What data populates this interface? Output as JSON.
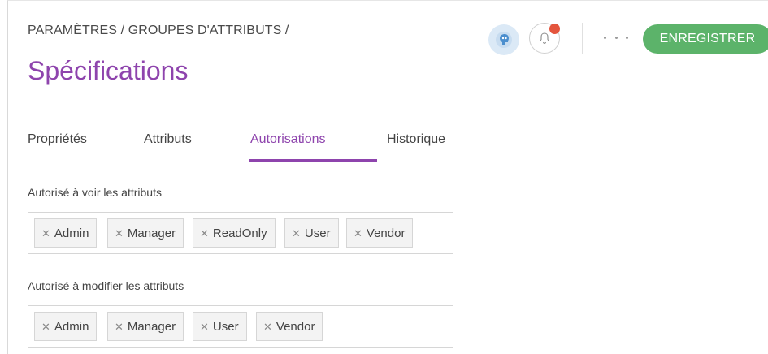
{
  "header": {
    "breadcrumb": "PARAMÈTRES / GROUPES D'ATTRIBUTS /",
    "title": "Spécifications",
    "save_label": "ENREGISTRER",
    "colors": {
      "accent": "#8e44ad",
      "save": "#5cb36a",
      "notification_dot": "#e4553d"
    }
  },
  "tabs": [
    {
      "label": "Propriétés"
    },
    {
      "label": "Attributs"
    },
    {
      "label": "Autorisations"
    },
    {
      "label": "Historique"
    }
  ],
  "active_tab": "Autorisations",
  "view_section": {
    "label": "Autorisé à voir les attributs",
    "tags": [
      "Admin",
      "Manager",
      "ReadOnly",
      "User",
      "Vendor"
    ]
  },
  "edit_section": {
    "label": "Autorisé à modifier les attributs",
    "tags": [
      "Admin",
      "Manager",
      "User",
      "Vendor"
    ]
  },
  "icons": {
    "avatar": "avatar-icon",
    "notifications": "bell-icon",
    "more": "more-icon",
    "remove_tag": "close-icon"
  }
}
